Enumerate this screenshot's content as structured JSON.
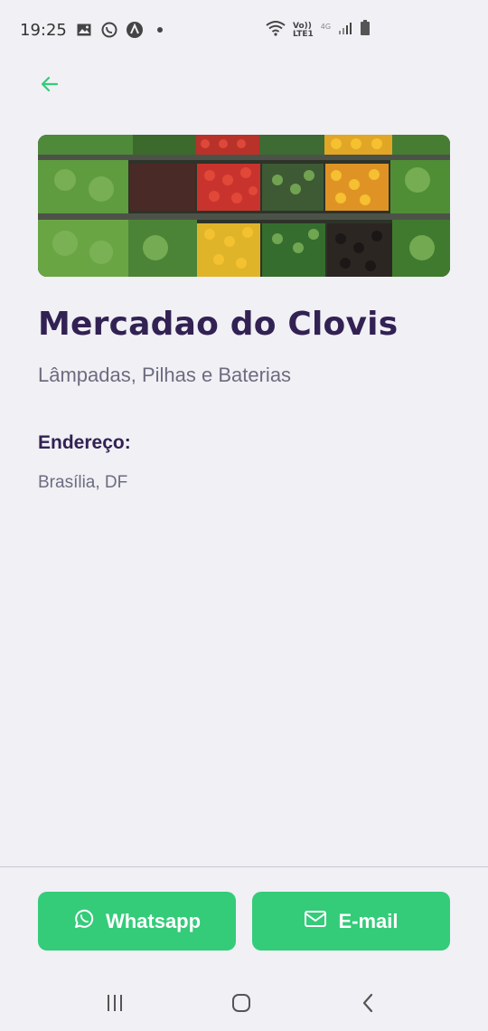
{
  "status_bar": {
    "time": "19:25",
    "left_icons": [
      "image-icon",
      "whatsapp-icon",
      "app-icon",
      "dot-icon"
    ],
    "right_icons": [
      "wifi-icon",
      "volte-icon",
      "signal-icon",
      "battery-icon"
    ],
    "volte_label_top": "Vo))",
    "volte_label_bottom": "LTE1",
    "network_label": "4G"
  },
  "header": {
    "back_icon": "arrow-left-icon"
  },
  "point": {
    "image_alt": "Mercado",
    "name": "Mercadao do Clovis",
    "items": "Lâmpadas, Pilhas e Baterias",
    "address_title": "Endereço:",
    "address": "Brasília, DF"
  },
  "footer": {
    "whatsapp_label": "Whatsapp",
    "email_label": "E-mail",
    "whatsapp_icon": "whatsapp-icon",
    "email_icon": "mail-icon"
  },
  "colors": {
    "accent": "#34cb79",
    "title": "#322153",
    "text": "#6c6c80",
    "background": "#f0f0f5"
  },
  "nav_bar": {
    "items": [
      "recent-apps-icon",
      "home-icon",
      "back-icon"
    ]
  }
}
